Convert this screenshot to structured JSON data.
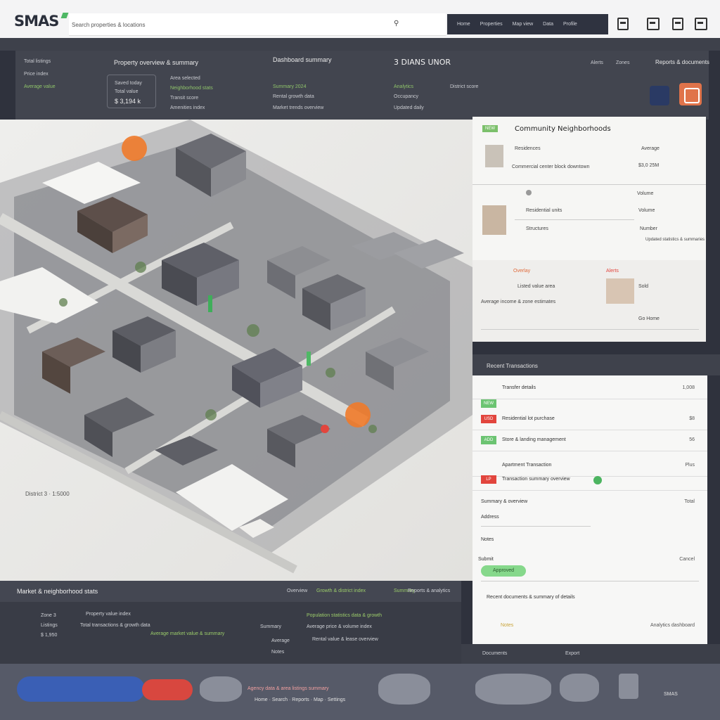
{
  "header": {
    "logo": "SMAS",
    "search_text": "Search properties & locations",
    "nav_items": [
      "Home",
      "Properties",
      "Map view",
      "Data",
      "Profile"
    ]
  },
  "info": {
    "title": "Property overview & summary",
    "subtitle": "Dashboard summary",
    "main_heading": "3 DIANS UNOR",
    "left_items": [
      "Total listings",
      "Price index",
      "Average value"
    ],
    "box_lines": [
      "Saved today",
      "Total value",
      "$ 3,194 k"
    ],
    "col2": [
      "Area selected",
      "Neighborhood stats",
      "Transit score",
      "Amenities index"
    ],
    "col3": [
      "Summary 2024",
      "Rental growth data",
      "Market trends overview"
    ],
    "col4": [
      "Analytics",
      "Occupancy",
      "District score",
      "Updated daily"
    ],
    "right_links": [
      "Alerts",
      "Zones",
      "Reports & documents"
    ]
  },
  "map": {
    "label": "District 3 · 1:5000"
  },
  "panel1": {
    "tag": "NEW",
    "title": "Community Neighborhoods",
    "item1": "Residences",
    "item1_sub": "Commercial center block downtown",
    "item1_val": "$3,0 25M",
    "rows": [
      "Residential units",
      "Structures"
    ],
    "row_vals": [
      "Average",
      "Volume",
      "Number"
    ],
    "note": "Updated statistics & summaries",
    "lower_tags": [
      "Overlay",
      "Alerts"
    ],
    "lower_lines": [
      "Listed value area",
      "Average income & zone estimates"
    ],
    "lower_vals": [
      "Sold",
      "Go Home"
    ]
  },
  "panel2": {
    "title": "Recent Transactions",
    "rows": [
      {
        "chip": "",
        "text": "Transfer details",
        "val": "1,008"
      },
      {
        "chip": "NEW",
        "text": "",
        "val": ""
      },
      {
        "chip": "USD",
        "text": "Residential lot purchase",
        "val": "$8"
      },
      {
        "chip": "ADD",
        "text": "Store & landing management",
        "val": "56"
      },
      {
        "chip": "",
        "text": "Apartment Transaction",
        "val": "Plus"
      },
      {
        "chip": "LP",
        "text": "Transaction summary overview",
        "val": ""
      }
    ],
    "section": "Summary & overview",
    "section_val": "Total",
    "items": [
      "Address",
      "Notes",
      "Submit"
    ],
    "items_right": "Cancel",
    "pill": "Approved",
    "bottom_line": "Recent documents & summary of details",
    "footer_left": "Notes",
    "footer_right": "Analytics dashboard"
  },
  "bottom": {
    "title": "Market & neighborhood stats",
    "head_right": [
      "Overview",
      "Growth & district index",
      "Summary",
      "Reports & analytics"
    ],
    "left_lines": [
      "Zone 3",
      "Listings",
      "$ 1,950"
    ],
    "col1": [
      "Property value index",
      "Total transactions & growth data",
      "Average market value & summary"
    ],
    "col2": [
      "Summary",
      "Average",
      "Notes"
    ],
    "col3": [
      "Population statistics data & growth",
      "Average price & volume index",
      "Rental value & lease overview"
    ],
    "links": [
      "Documents",
      "Export"
    ]
  },
  "footer": {
    "text1": "Agency data & area listings summary",
    "text2": "Home · Search · Reports · Map · Settings",
    "right_label": "SMAS"
  }
}
